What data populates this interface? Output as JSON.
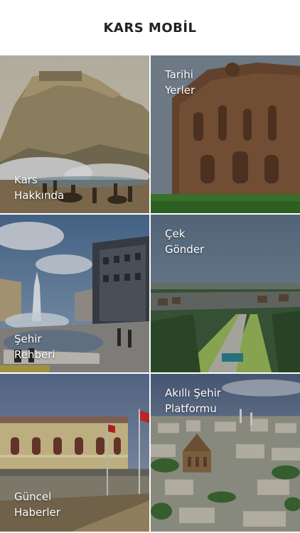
{
  "header": {
    "title": "KARS MOBİL"
  },
  "tiles": [
    {
      "line1": "Kars",
      "line2": "Hakkında",
      "icon": "kars-castle-painting"
    },
    {
      "line1": "Tarihi",
      "line2": "Yerler",
      "icon": "historic-church"
    },
    {
      "line1": "Şehir",
      "line2": "Rehberi",
      "icon": "city-fountain"
    },
    {
      "line1": "Çek",
      "line2": "Gönder",
      "icon": "park-aerial"
    },
    {
      "line1": "Güncel",
      "line2": "Haberler",
      "icon": "government-building"
    },
    {
      "line1": "Akıllı Şehir",
      "line2": "Platformu",
      "icon": "city-panorama"
    }
  ],
  "colors": {
    "header_background": "#ffffff",
    "header_text": "#222222",
    "tile_label": "#ffffff"
  }
}
